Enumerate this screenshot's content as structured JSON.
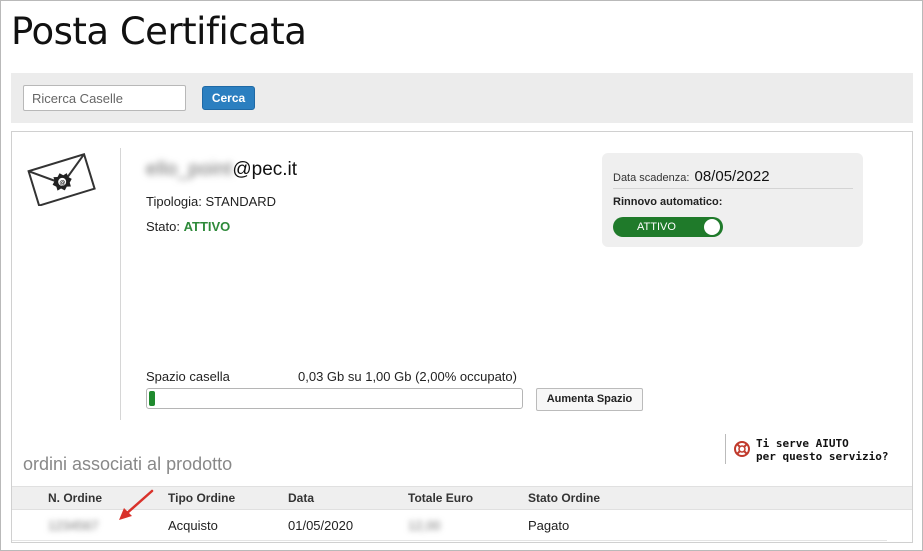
{
  "page_title": "Posta Certificata",
  "search": {
    "placeholder": "Ricerca Caselle",
    "value": "",
    "button_label": "Cerca"
  },
  "mailbox": {
    "email_masked": "ello_point",
    "email_domain": "@pec.it",
    "type_label": "Tipologia:",
    "type_value": "STANDARD",
    "status_label": "Stato:",
    "status_value": "ATTIVO",
    "expiry_label": "Data scadenza:",
    "expiry_value": "08/05/2022",
    "auto_renew_label": "Rinnovo automatico:",
    "auto_renew_value": "ATTIVO",
    "space_label": "Spazio casella",
    "space_value": "0,03 Gb su 1,00 Gb (2,00% occupato)",
    "space_used_percent": 2,
    "increase_button": "Aumenta Spazio"
  },
  "help": {
    "line1": "Ti serve AIUTO",
    "line2": "per questo servizio?"
  },
  "orders": {
    "title": "ordini associati al prodotto",
    "columns": [
      "N. Ordine",
      "Tipo Ordine",
      "Data",
      "Totale Euro",
      "Stato Ordine"
    ],
    "rows": [
      {
        "number": "1234567",
        "type": "Acquisto",
        "date": "01/05/2020",
        "total": "12,00",
        "status": "Pagato"
      }
    ]
  },
  "colors": {
    "accent": "#2b7fc0",
    "active_green": "#1f7a2a",
    "status_green": "#2e8a3a",
    "arrow_red": "#d9322b"
  }
}
